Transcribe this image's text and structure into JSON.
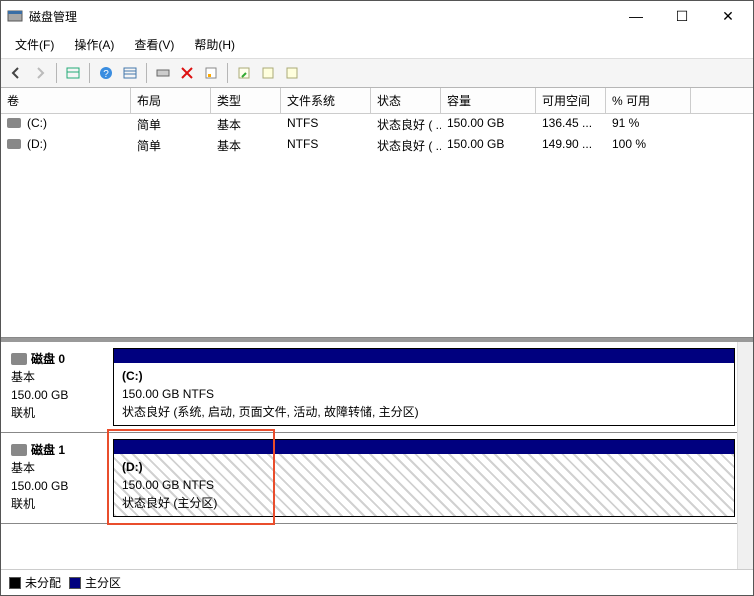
{
  "window": {
    "title": "磁盘管理",
    "min": "—",
    "max": "☐",
    "close": "✕"
  },
  "menu": {
    "file": "文件(F)",
    "action": "操作(A)",
    "view": "查看(V)",
    "help": "帮助(H)"
  },
  "columns": {
    "volume": "卷",
    "layout": "布局",
    "type": "类型",
    "filesystem": "文件系统",
    "status": "状态",
    "capacity": "容量",
    "free": "可用空间",
    "pct": "% 可用"
  },
  "volumes": [
    {
      "name": "(C:)",
      "layout": "简单",
      "type": "基本",
      "fs": "NTFS",
      "status": "状态良好 ( ...",
      "capacity": "150.00 GB",
      "free": "136.45 ...",
      "pct": "91 %"
    },
    {
      "name": "(D:)",
      "layout": "简单",
      "type": "基本",
      "fs": "NTFS",
      "status": "状态良好 ( ...",
      "capacity": "150.00 GB",
      "free": "149.90 ...",
      "pct": "100 %"
    }
  ],
  "disks": [
    {
      "label": "磁盘 0",
      "kind": "基本",
      "size": "150.00 GB",
      "state": "联机",
      "part": {
        "title": "(C:)",
        "line2": "150.00 GB NTFS",
        "line3": "状态良好 (系统, 启动, 页面文件, 活动, 故障转储, 主分区)",
        "hatched": false
      }
    },
    {
      "label": "磁盘 1",
      "kind": "基本",
      "size": "150.00 GB",
      "state": "联机",
      "part": {
        "title": "(D:)",
        "line2": "150.00 GB NTFS",
        "line3": "状态良好 (主分区)",
        "hatched": true
      }
    }
  ],
  "legend": {
    "unallocated": "未分配",
    "primary": "主分区"
  }
}
